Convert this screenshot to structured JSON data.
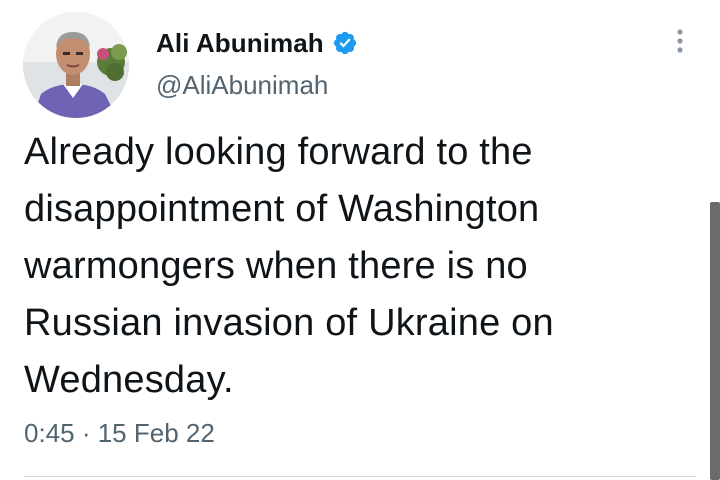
{
  "author": {
    "display_name": "Ali Abunimah",
    "handle": "@AliAbunimah",
    "verified": true
  },
  "tweet": {
    "lines": [
      "Already looking forward to the",
      "disappointment of Washington",
      "warmongers when there is no",
      "Russian invasion of Ukraine on",
      "Wednesday."
    ],
    "timestamp": "0:45 · 15 Feb 22"
  },
  "icons": {
    "verified": "verified-badge-icon",
    "more": "more-options-icon"
  },
  "colors": {
    "verified_blue": "#1d9bf0",
    "secondary_text": "#536471",
    "primary_text": "#0f1419"
  }
}
